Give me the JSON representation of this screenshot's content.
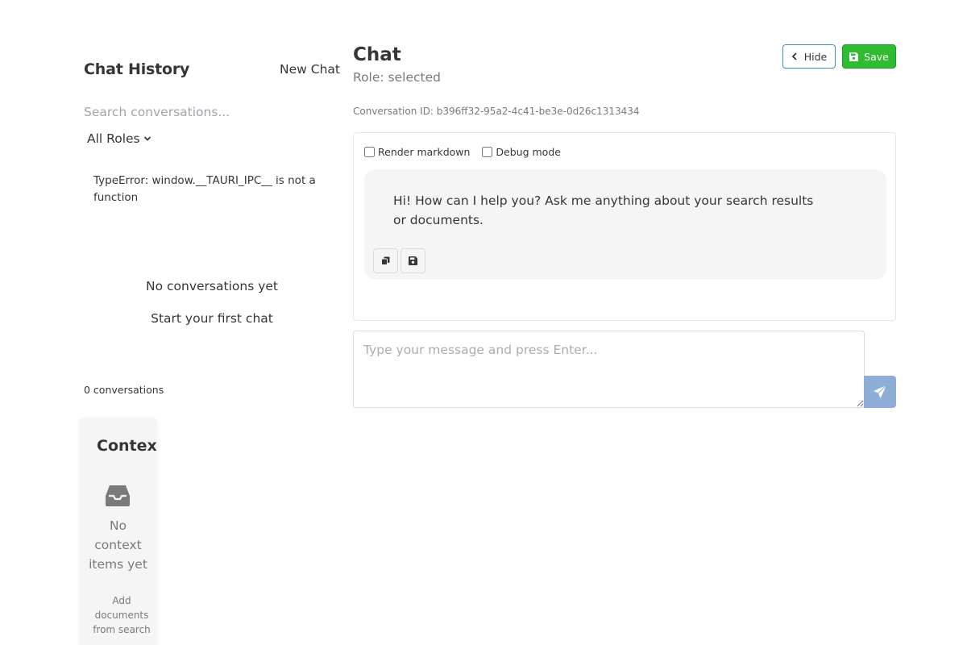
{
  "sidebar": {
    "title": "Chat History",
    "new_chat_label": "New Chat",
    "search_placeholder": "Search conversations...",
    "role_filter": "All Roles",
    "error_text": "TypeError: window.__TAURI_IPC__ is not a function",
    "empty_title": "No conversations yet",
    "empty_subtitle": "Start your first chat",
    "conversation_count": "0 conversations"
  },
  "context": {
    "title": "Context",
    "empty_text": "No context items yet",
    "hint_text": "Add documents from search"
  },
  "main": {
    "title": "Chat",
    "role_line": "Role: selected",
    "hide_label": "Hide",
    "save_label": "Save",
    "conversation_id": "Conversation ID: b396ff32-95a2-4c41-be3e-0d26c1313434",
    "render_markdown_label": "Render markdown",
    "debug_mode_label": "Debug mode",
    "assistant_message": "Hi! How can I help you? Ask me anything about your search results or documents.",
    "input_placeholder": "Type your message and press Enter..."
  },
  "colors": {
    "hide_border": "#3e8ed0",
    "save_bg": "#2ebd30",
    "send_bg": "#8eaed7",
    "bubble_bg": "#f5f5f5"
  },
  "icons": {
    "hide": "chevron-left-icon",
    "save": "floppy-disk-icon",
    "copy": "copy-icon",
    "save_message": "floppy-disk-icon",
    "send": "paper-plane-icon",
    "context_empty": "inbox-icon",
    "role_dropdown": "chevron-down-icon"
  }
}
